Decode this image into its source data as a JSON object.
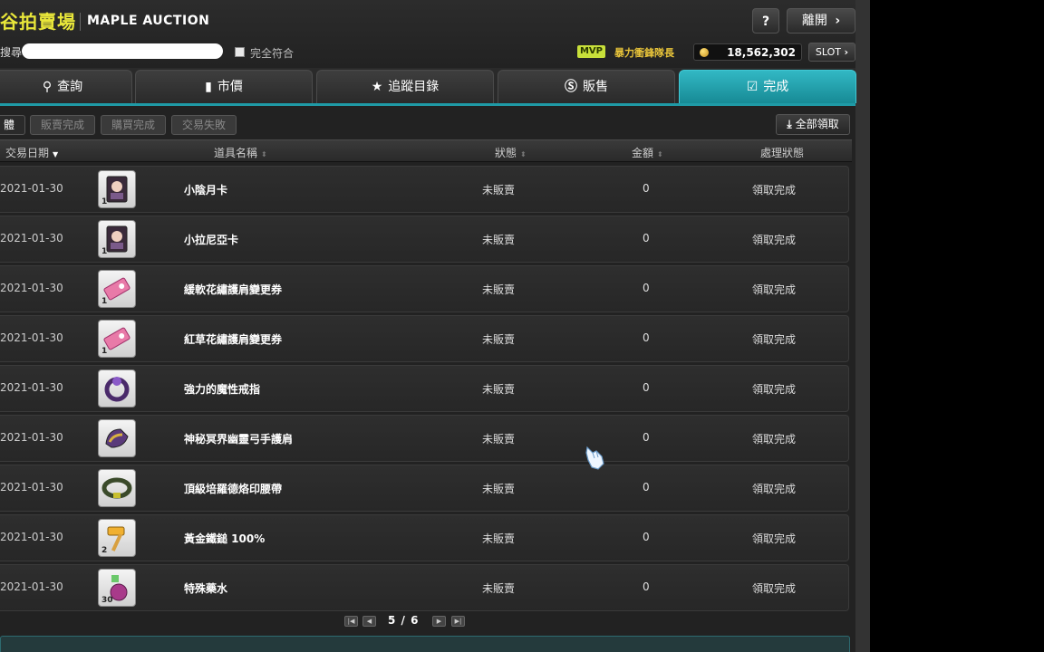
{
  "header": {
    "title_cn": "谷拍賣場",
    "title_en": "MAPLE AUCTION",
    "help_label": "?",
    "exit_label": "離開"
  },
  "search": {
    "label": "搜尋",
    "placeholder": "",
    "value": "",
    "exact_match_label": "完全符合",
    "exact_match_checked": false
  },
  "account": {
    "mvp_badge": "MVP",
    "character_name": "暴力衝鋒隊長",
    "mesos": "18,562,302",
    "slot_label": "SLOT"
  },
  "tabs": [
    {
      "label": "查詢",
      "icon": "search-icon",
      "active": false
    },
    {
      "label": "市價",
      "icon": "chart-icon",
      "active": false
    },
    {
      "label": "追蹤目錄",
      "icon": "star-icon",
      "active": false
    },
    {
      "label": "販售",
      "icon": "coin-s-icon",
      "active": false
    },
    {
      "label": "完成",
      "icon": "check-box-icon",
      "active": true
    }
  ],
  "filters": [
    {
      "label": "體",
      "selected": true
    },
    {
      "label": "販賣完成",
      "selected": false
    },
    {
      "label": "購買完成",
      "selected": false
    },
    {
      "label": "交易失敗",
      "selected": false
    }
  ],
  "claim_all_label": "全部領取",
  "columns": {
    "date": "交易日期",
    "name": "道具名稱",
    "status": "狀態",
    "amount": "金額",
    "process": "處理狀態"
  },
  "rows": [
    {
      "date": "2021-01-30",
      "name": "小陰月卡",
      "status": "未販賣",
      "amount": "0",
      "process": "領取完成",
      "icon": "card-icon",
      "qty": "1"
    },
    {
      "date": "2021-01-30",
      "name": "小拉尼亞卡",
      "status": "未販賣",
      "amount": "0",
      "process": "領取完成",
      "icon": "card-icon",
      "qty": "1"
    },
    {
      "date": "2021-01-30",
      "name": "緩軟花繡護肩變更券",
      "status": "未販賣",
      "amount": "0",
      "process": "領取完成",
      "icon": "ticket-icon",
      "qty": "1"
    },
    {
      "date": "2021-01-30",
      "name": "紅草花繡護肩變更券",
      "status": "未販賣",
      "amount": "0",
      "process": "領取完成",
      "icon": "ticket-icon",
      "qty": "1"
    },
    {
      "date": "2021-01-30",
      "name": "強力的魔性戒指",
      "status": "未販賣",
      "amount": "0",
      "process": "領取完成",
      "icon": "ring-icon",
      "qty": ""
    },
    {
      "date": "2021-01-30",
      "name": "神秘冥界幽靈弓手護肩",
      "status": "未販賣",
      "amount": "0",
      "process": "領取完成",
      "icon": "shoulder-icon",
      "qty": ""
    },
    {
      "date": "2021-01-30",
      "name": "頂級培羅德烙印腰帶",
      "status": "未販賣",
      "amount": "0",
      "process": "領取完成",
      "icon": "belt-icon",
      "qty": ""
    },
    {
      "date": "2021-01-30",
      "name": "黃金鐵鎚 100%",
      "status": "未販賣",
      "amount": "0",
      "process": "領取完成",
      "icon": "hammer-icon",
      "qty": "2"
    },
    {
      "date": "2021-01-30",
      "name": "特殊藥水",
      "status": "未販賣",
      "amount": "0",
      "process": "領取完成",
      "icon": "potion-icon",
      "qty": "30"
    }
  ],
  "pagination": {
    "current": "5",
    "separator": "/",
    "total": "6"
  },
  "colors": {
    "active_tab": "#1f9aa6",
    "title": "#e9e73a",
    "mvp": "#c8e03a"
  }
}
